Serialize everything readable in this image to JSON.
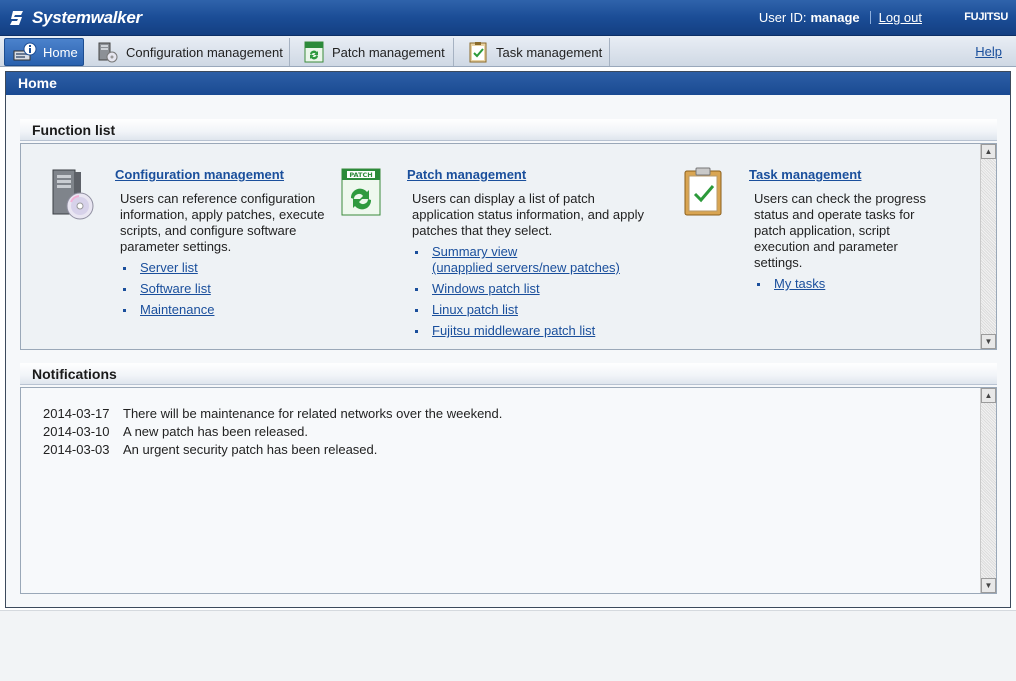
{
  "header": {
    "logo_text": "Systemwalker",
    "user_id_label": "User ID:",
    "user_id_value": "manage",
    "logout_label": "Log out",
    "brand": "FUJITSU"
  },
  "tabs": [
    {
      "label": "Home",
      "icon": "home-info-icon",
      "active": true
    },
    {
      "label": "Configuration management",
      "icon": "server-config-icon",
      "active": false
    },
    {
      "label": "Patch management",
      "icon": "patch-icon",
      "active": false
    },
    {
      "label": "Task management",
      "icon": "task-clipboard-icon",
      "active": false
    }
  ],
  "help_label": "Help",
  "page_title": "Home",
  "function_list": {
    "title": "Function list",
    "items": [
      {
        "title": "Configuration management",
        "icon": "server-disc-icon",
        "description": "Users can reference configuration information, apply patches, execute scripts, and configure software parameter settings.",
        "links": [
          "Server list",
          "Software list",
          "Maintenance"
        ]
      },
      {
        "title": "Patch management",
        "icon": "patch-icon",
        "description": "Users can display a list of patch application status information, and apply patches that they select.",
        "links": [
          "Summary view",
          "Windows patch list",
          "Linux patch list",
          "Fujitsu middleware patch list"
        ],
        "summary_sub": "(unapplied servers/new patches)"
      },
      {
        "title": "Task management",
        "icon": "task-clipboard-icon",
        "description": "Users can check the progress status and operate tasks for patch application, script execution and parameter settings.",
        "links": [
          "My tasks"
        ]
      }
    ]
  },
  "notifications": {
    "title": "Notifications",
    "items": [
      {
        "date": "2014-03-17",
        "text": "There will be maintenance for related networks over the weekend."
      },
      {
        "date": "2014-03-10",
        "text": "A new patch has been released."
      },
      {
        "date": "2014-03-03",
        "text": "An urgent security patch has been released."
      }
    ]
  },
  "colors": {
    "header_blue": "#1b4d96",
    "link_blue": "#1a4f9c",
    "panel_bg": "#eef2f5"
  }
}
